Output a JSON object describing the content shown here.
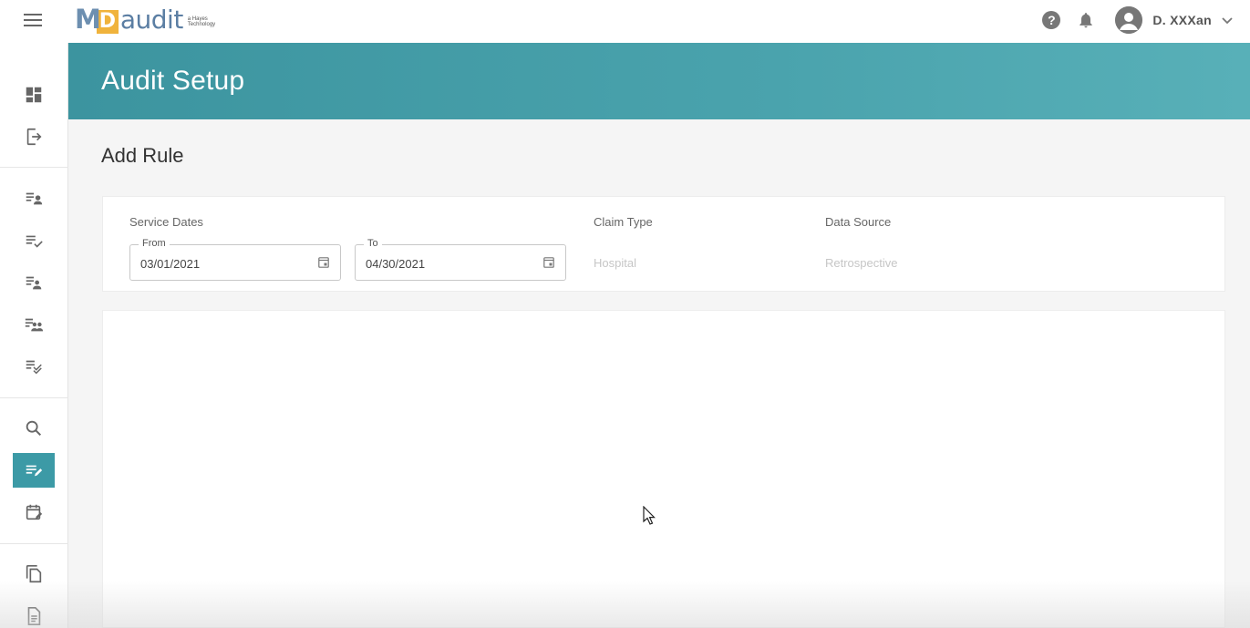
{
  "app": {
    "logo_m": "M",
    "logo_d": "D",
    "logo_audit": "audit",
    "logo_sub_line1": "a Hayes",
    "logo_sub_line2": "Technology"
  },
  "header": {
    "user_name": "D. XXXan",
    "help_icon": "?",
    "icons": [
      "menu-icon",
      "help-icon",
      "bell-icon",
      "avatar-icon",
      "chevron-down-icon"
    ]
  },
  "sidebar": {
    "items": [
      {
        "name": "dashboard",
        "icon": "dashboard-icon"
      },
      {
        "name": "logout",
        "icon": "exit-icon"
      },
      {
        "name": "assigned-list",
        "icon": "list-person-icon"
      },
      {
        "name": "checked-list",
        "icon": "list-check-icon"
      },
      {
        "name": "person-list",
        "icon": "list-person-icon"
      },
      {
        "name": "group-list",
        "icon": "list-group-icon"
      },
      {
        "name": "double-check-list",
        "icon": "list-double-check-icon"
      },
      {
        "name": "search",
        "icon": "search-icon"
      },
      {
        "name": "audit-setup",
        "icon": "list-edit-icon",
        "active": true
      },
      {
        "name": "calendar",
        "icon": "calendar-edit-icon"
      },
      {
        "name": "copy",
        "icon": "copy-icon"
      },
      {
        "name": "document",
        "icon": "document-icon"
      }
    ]
  },
  "banner": {
    "title": "Audit Setup"
  },
  "page": {
    "title": "Add Rule"
  },
  "filters": {
    "service_dates_label": "Service Dates",
    "from_legend": "From",
    "from_value": "03/01/2021",
    "to_legend": "To",
    "to_value": "04/30/2021",
    "claim_type_label": "Claim Type",
    "claim_type_value": "Hospital",
    "data_source_label": "Data Source",
    "data_source_value": "Retrospective"
  },
  "colors": {
    "accent": "#3c9aa6",
    "banner_start": "#3c949f",
    "banner_end": "#58b0b8",
    "logo_blue": "#5b7ea3",
    "logo_orange": "#f0b33c"
  }
}
